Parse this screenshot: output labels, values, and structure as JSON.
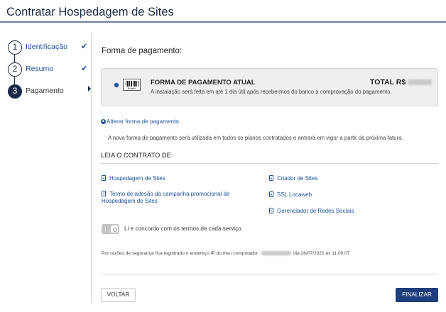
{
  "page": {
    "title": "Contratar Hospedagem de Sites"
  },
  "steps": [
    {
      "number": "1",
      "label": "Identificação",
      "done": true
    },
    {
      "number": "2",
      "label": "Resumo",
      "done": true
    },
    {
      "number": "3",
      "label": "Pagamento",
      "done": false,
      "active": true
    }
  ],
  "payment": {
    "section_title": "Forma de pagamento:",
    "method_title": "FORMA DE PAGAMENTO ATUAL",
    "method_description": "A instalação será feita em até 1 dia útil após recebermos do banco a comprovação do pagamento.",
    "barcode_label": "Boleto",
    "total_label": "TOTAL R$",
    "change_link": "Alterar forma de pagamento",
    "notice": "A nova forma de pagamento será utilizada em todos os planos contratados e entrará em vigor a partir da próxima fatura."
  },
  "contracts": {
    "title": "LEIA O CONTRATO DE:",
    "left": [
      "Hospedagem de Sites",
      "Termo de adesão da campanha promocional de Hospedagem de Sites"
    ],
    "right": [
      "Criador de Sites",
      "SSL Locaweb",
      "Gerenciador de Redes Sociais"
    ]
  },
  "agreement": {
    "label": "Li e concordo com os termos de cada serviço.",
    "checked": false
  },
  "security": {
    "prefix": "Por razões de segurança fica registrado o endereço IP do meu computador:",
    "suffix": "dia 28/07/2021 às 11:06:07"
  },
  "buttons": {
    "back": "VOLTAR",
    "finish": "FINALIZAR"
  },
  "colors": {
    "primary": "#1d3f7d",
    "link": "#1d4f9a",
    "panel": "#efefef"
  }
}
